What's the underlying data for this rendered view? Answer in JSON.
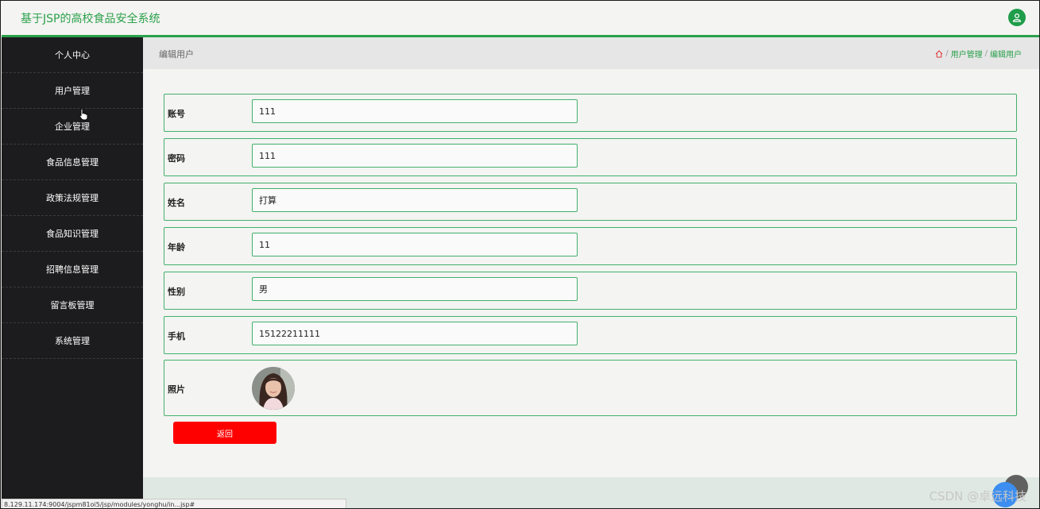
{
  "header": {
    "title": "基于JSP的高校食品安全系统",
    "user_icon": "user-icon",
    "accent_color": "#2aa04a"
  },
  "sidebar": {
    "items": [
      {
        "label": "个人中心"
      },
      {
        "label": "用户管理"
      },
      {
        "label": "企业管理"
      },
      {
        "label": "食品信息管理"
      },
      {
        "label": "政策法规管理"
      },
      {
        "label": "食品知识管理"
      },
      {
        "label": "招聘信息管理"
      },
      {
        "label": "留言板管理"
      },
      {
        "label": "系统管理"
      }
    ]
  },
  "page": {
    "title": "编辑用户",
    "breadcrumb": {
      "home_icon": "home-icon",
      "sep1": "/",
      "level1": "用户管理",
      "sep2": "/",
      "level2": "编辑用户"
    }
  },
  "form": {
    "fields": [
      {
        "label": "账号",
        "value": "111"
      },
      {
        "label": "密码",
        "value": "111"
      },
      {
        "label": "姓名",
        "value": "打算"
      },
      {
        "label": "年龄",
        "value": "11"
      },
      {
        "label": "性别",
        "value": "男"
      },
      {
        "label": "手机",
        "value": "15122211111"
      }
    ],
    "photo_label": "照片",
    "back_button": "返回"
  },
  "browser": {
    "status_url": "8.129.11.174:9004/jspm81oi5/jsp/modules/yonghu/in...jsp#"
  },
  "watermark": "CSDN @卓远科技"
}
